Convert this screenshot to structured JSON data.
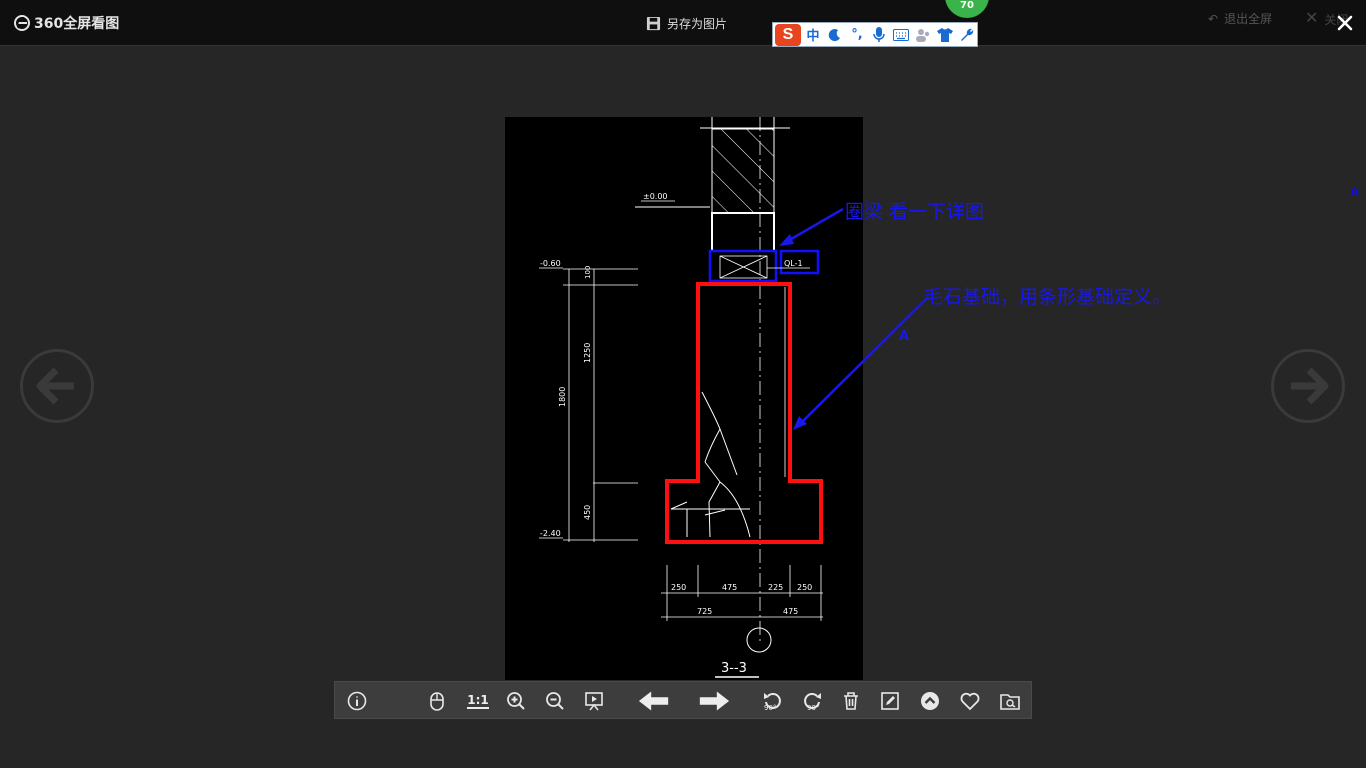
{
  "app": {
    "title": "360全屏看图",
    "save_label": "另存为图片",
    "exit_fullscreen": "退出全屏",
    "close_label": "关闭"
  },
  "ime": {
    "badge": "70",
    "mode": "中"
  },
  "drawing": {
    "section_title": "3--3",
    "level_top": "±0.00",
    "level_mid": "-0.60",
    "level_bottom": "-2.40",
    "beam_label": "QL-1",
    "dim_vertical": [
      "100",
      "1250",
      "1800",
      "450"
    ],
    "dim_top_row": [
      "250",
      "475",
      "225",
      "250"
    ],
    "dim_bottom_row": [
      "725",
      "475"
    ],
    "marker_a": "A"
  },
  "annotations": {
    "beam_note": "圈梁 看一下详图",
    "foundation_note": "毛石基础，用条形基础定义。",
    "marker": "A",
    "side_marker": "A",
    "color": "#1818e8"
  },
  "toolbar": {
    "info": "info-icon",
    "mouse": "mouse-icon",
    "actual_size": "1:1",
    "zoom_in": "zoom-in-icon",
    "zoom_out": "zoom-out-icon",
    "slideshow": "slideshow-icon",
    "prev": "arrow-left-icon",
    "next": "arrow-right-icon",
    "rotate_ccw": "90°",
    "rotate_cw": "90°",
    "delete": "trash-icon",
    "edit": "edit-icon",
    "more": "chevron-up-icon",
    "favorite": "heart-icon",
    "open_folder": "folder-search-icon"
  }
}
